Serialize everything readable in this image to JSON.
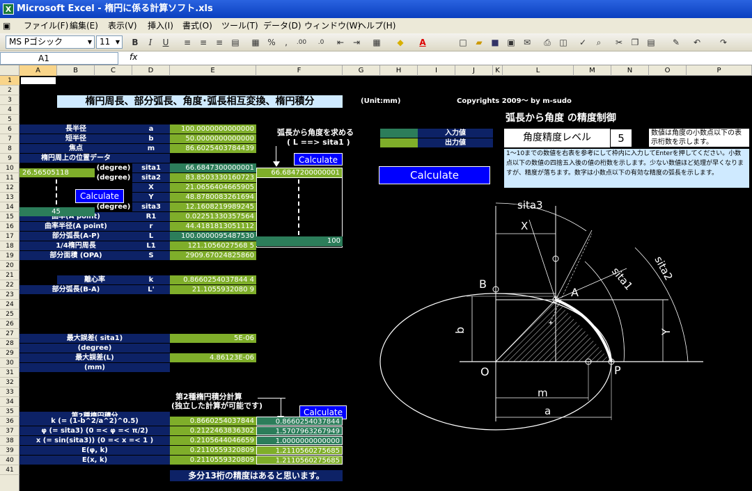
{
  "window": {
    "title": "Microsoft Excel - 楕円に係る計算ソフト.xls",
    "app_icon": "X"
  },
  "menu": [
    "ファイル(F)",
    "編集(E)",
    "表示(V)",
    "挿入(I)",
    "書式(O)",
    "ツール(T)",
    "データ(D)",
    "ウィンドウ(W)",
    "ヘルプ(H)"
  ],
  "toolbar": {
    "font": "MS Pゴシック",
    "size": "11",
    "bold": "B",
    "italic": "I",
    "underline": "U",
    "font_color": "A"
  },
  "formula_bar": {
    "name_box": "A1",
    "fx": "fx"
  },
  "columns": [
    "A",
    "B",
    "C",
    "D",
    "E",
    "F",
    "G",
    "H",
    "I",
    "J",
    "K",
    "L",
    "M",
    "N",
    "O",
    "P"
  ],
  "rows": [
    "1",
    "2",
    "3",
    "4",
    "5",
    "6",
    "7",
    "8",
    "9",
    "10",
    "11",
    "12",
    "13",
    "14",
    "15",
    "16",
    "17",
    "18",
    "19",
    "20",
    "21",
    "22",
    "23",
    "24",
    "25",
    "26",
    "27",
    "28",
    "29",
    "30",
    "31",
    "32",
    "33",
    "34",
    "35",
    "36",
    "37",
    "38",
    "39",
    "40",
    "41"
  ],
  "sheet": {
    "title": "楕円周長、部分弧長、角度･弧長相互変換、楕円積分",
    "unit": "(Unit:mm)",
    "copyright": "Copyrights 2009～ by m-sudo",
    "precision_title": "弧長から角度 の精度制御",
    "precision_label": "角度精度レベル",
    "precision_value": "5",
    "precision_note": "数値は角度の小数点以下の表示桁数を示します。",
    "precision_desc": "1～10までの数値を右表を参考にして枠内に入力してEnterを押してください。小数点以下の数値の四捨五入後の値の桁数を示します。少ない数値ほど処理が早くなりますが、精度が落ちます。数字は小数点以下の有効な精度の弧長を示します。",
    "arc_to_angle_title": "弧長から角度を求める",
    "arc_to_angle_sub": "( L ==> sita1 )",
    "legend_input": "入力値",
    "legend_output": "出力値",
    "calc": "Calculate",
    "rows_main": [
      {
        "label": "長半径",
        "sym": "a",
        "value": "100.0000000000000"
      },
      {
        "label": "短半径",
        "sym": "b",
        "value": "50.0000000000000"
      },
      {
        "label": "焦点",
        "sym": "m",
        "value": "86.6025403784439"
      },
      {
        "label": "楕円周上の位置データ",
        "sym": "",
        "value": ""
      },
      {
        "label": "(degree)",
        "sym": "sita1",
        "value": "66.6847300000001"
      },
      {
        "label": "(degree)",
        "sym": "sita2",
        "value": "83.8503330160723"
      },
      {
        "label": "",
        "sym": "X",
        "value": "21.0656404665905"
      },
      {
        "label": "",
        "sym": "Y",
        "value": "48.8780083261694"
      },
      {
        "label": "(degree)",
        "sym": "sita3",
        "value": "12.1608219989245"
      },
      {
        "label": "曲率(A point)",
        "sym": "R1",
        "value": "0.02251330357564"
      },
      {
        "label": "曲率半径(A point)",
        "sym": "r",
        "value": "44.4181813051112"
      },
      {
        "label": "部分弧長(A-P)",
        "sym": "L",
        "value": "100.0000095487530"
      },
      {
        "label": "1/4楕円周長",
        "sym": "L1",
        "value": "121.1056027568 5"
      },
      {
        "label": "部分面積 (OPA)",
        "sym": "S",
        "value": "2909.67024825860"
      }
    ],
    "a10": "26.56505118",
    "a14": "45",
    "f10": "66.6847200000001",
    "f17": "100",
    "k_label": "離心率",
    "k_sym": "k",
    "k_value": "0.8660254037844 4",
    "lb_label": "部分弧長(B-A)",
    "lb_sym": "L'",
    "lb_value": "21.1055932080 9",
    "err1_label": "最大誤差( sita1)",
    "err1_unit": "(degree)",
    "err1_value": "5E-06",
    "err2_label": "最大誤差(L)",
    "err2_unit": "(mm)",
    "err2_value": "4.86123E-06",
    "int2_note1": "第2種楕円積分計算",
    "int2_note2": "(独立した計算が可能です)",
    "int2_title": "第2種楕円積分",
    "int_rows": [
      {
        "label": "k (= (1-b^2/a^2)^0.5)",
        "e": "0.8660254037844",
        "f": "0.8660254037844"
      },
      {
        "label": "φ (= sita3) (0 =< φ =< π/2)",
        "e": "0.2122463836302",
        "f": "1.5707963267949"
      },
      {
        "label": "x (= sin(sita3)) (0 =< x =< 1 )",
        "e": "0.2105644046659",
        "f": "1.0000000000000"
      },
      {
        "label": "E(φ, k)",
        "e": "0.2110559320809",
        "f": "1.2110560275685"
      },
      {
        "label": "E(x, k)",
        "e": "0.2110559320809",
        "f": "1.2110560275685"
      }
    ],
    "footer": "多分13桁の精度はあると思います。"
  },
  "diagram": {
    "labels": {
      "sita3": "sita3",
      "X": "X",
      "sita1": "sita1",
      "sita2": "sita2",
      "A": "A",
      "B": "B",
      "b": "b",
      "Y": "Y",
      "O": "O",
      "P": "P",
      "m": "m",
      "a": "a"
    }
  }
}
